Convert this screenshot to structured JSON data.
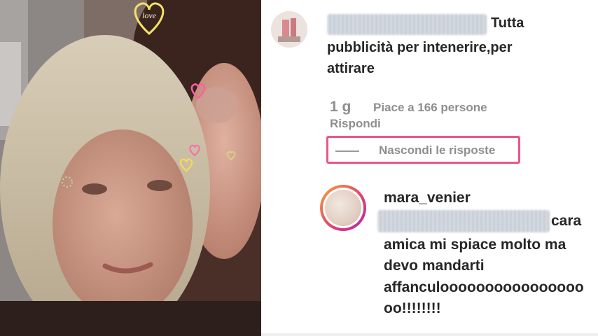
{
  "comment1": {
    "text_line1": "Tutta",
    "text_line2": "pubblicità per intenerire,per",
    "text_line3": "attirare",
    "time": "1 g",
    "likes": "Piace a 166 persone",
    "reply_action": "Rispondi",
    "hide_replies": "Nascondi le risposte"
  },
  "reply": {
    "username": "mara_venier",
    "line1_end": "cara",
    "line2": "amica mi spiace molto ma",
    "line3": "devo mandarti",
    "line4": "affanculoooooooooooooooo",
    "line5": "oo!!!!!!!!"
  },
  "photo": {
    "sticker_heart_text": "love"
  },
  "colors": {
    "highlight_box": "#e8578a",
    "avatar_ring": "#e53b6f",
    "text": "#262626",
    "meta": "#8e8e8e"
  }
}
